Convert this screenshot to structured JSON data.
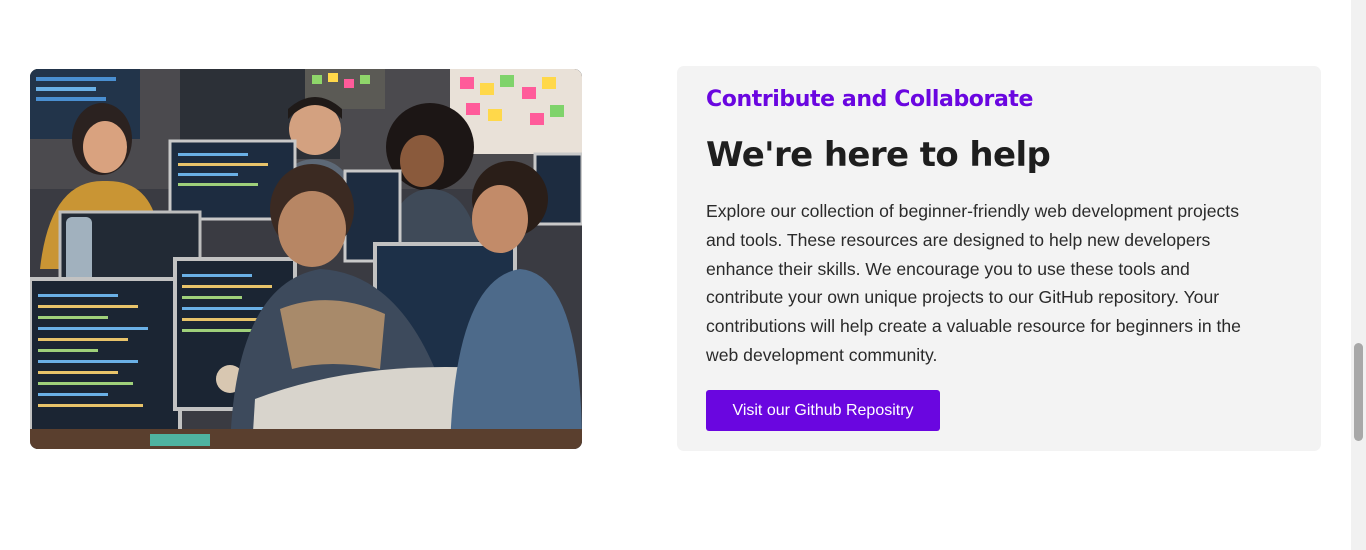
{
  "section": {
    "image_alt": "Developers collaborating at computers in an office",
    "eyebrow": "Contribute and Collaborate",
    "headline": "We're here to help",
    "body": "Explore our collection of beginner-friendly web development projects and tools. These resources are designed to help new developers enhance their skills. We encourage you to use these tools and contribute your own unique projects to our GitHub repository. Your contributions will help create a valuable resource for beginners in the web development community.",
    "button_label": "Visit our Github Repositry"
  },
  "colors": {
    "accent": "#6a06e0",
    "card_background": "#f3f3f3",
    "heading": "#1e1e1e",
    "body_text": "#2a2a2a"
  }
}
